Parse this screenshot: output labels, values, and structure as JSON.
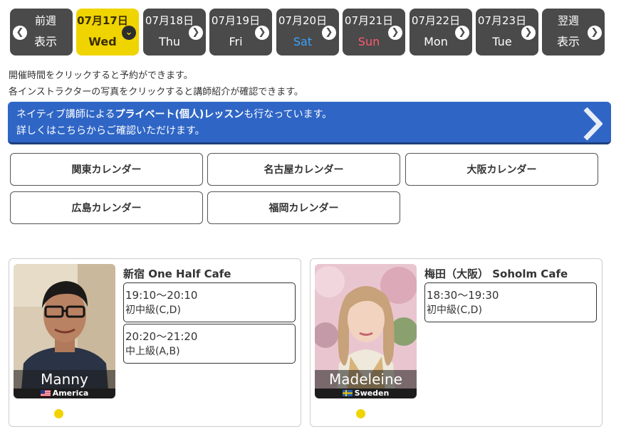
{
  "day_tabs": [
    {
      "line1": "前週",
      "line2": "表示",
      "kind": "prev"
    },
    {
      "line1": "07月17日",
      "line2": "Wed",
      "kind": "active"
    },
    {
      "line1": "07月18日",
      "line2": "Thu",
      "kind": "day"
    },
    {
      "line1": "07月19日",
      "line2": "Fri",
      "kind": "day"
    },
    {
      "line1": "07月20日",
      "line2": "Sat",
      "kind": "sat"
    },
    {
      "line1": "07月21日",
      "line2": "Sun",
      "kind": "sun"
    },
    {
      "line1": "07月22日",
      "line2": "Mon",
      "kind": "day"
    },
    {
      "line1": "07月23日",
      "line2": "Tue",
      "kind": "day"
    },
    {
      "line1": "翌週",
      "line2": "表示",
      "kind": "next"
    }
  ],
  "notices": {
    "line1": "開催時間をクリックすると予約ができます。",
    "line2": "各インストラクターの写真をクリックすると講師紹介が確認できます。"
  },
  "banner": {
    "prefix": "ネイティブ講師による",
    "emphasis": "プライベート(個人)レッスン",
    "suffix": "も行なっています。",
    "line2": "詳しくはこちらからご確認いただけます。"
  },
  "regions": [
    "関東カレンダー",
    "名古屋カレンダー",
    "大阪カレンダー",
    "広島カレンダー",
    "福岡カレンダー"
  ],
  "lessons": [
    {
      "instructor": "Manny",
      "country": "America",
      "venue": "新宿 One Half Cafe",
      "slots": [
        {
          "time": "19:10～20:10",
          "level": "初中級(C,D)"
        },
        {
          "time": "20:20～21:20",
          "level": "中上級(A,B)"
        }
      ]
    },
    {
      "instructor": "Madeleine",
      "country": "Sweden",
      "venue": "梅田（大阪） Soholm Cafe",
      "slots": [
        {
          "time": "18:30～19:30",
          "level": "初中級(C,D)"
        }
      ]
    }
  ],
  "colors": {
    "active_tab": "#f0d400",
    "tab": "#4a4a4a",
    "banner": "#2f66c6",
    "saturday": "#3aa3ff",
    "sunday": "#ff5a6e",
    "dot": "#f0d400"
  }
}
